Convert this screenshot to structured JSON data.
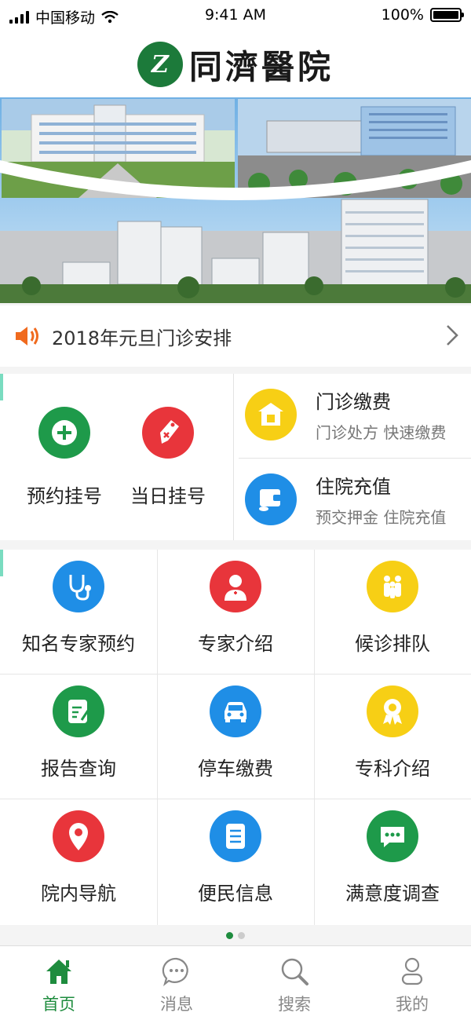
{
  "status_bar": {
    "carrier": "中国移动",
    "time": "9:41 AM",
    "battery": "100%"
  },
  "header": {
    "logo_mark": "Z",
    "title": "同濟醫院"
  },
  "notice": {
    "text": "2018年元旦门诊安排"
  },
  "features": {
    "left": [
      {
        "label": "预约挂号",
        "icon": "plus-icon",
        "color": "#1e9a4a"
      },
      {
        "label": "当日挂号",
        "icon": "tag-icon",
        "color": "#e8353b"
      }
    ],
    "right": [
      {
        "title": "门诊缴费",
        "subtitle": "门诊处方  快速缴费",
        "icon": "clinic-icon",
        "color": "#f7cf15"
      },
      {
        "title": "住院充值",
        "subtitle": "预交押金  住院充值",
        "icon": "wallet-icon",
        "color": "#1f8ee6"
      }
    ]
  },
  "grid": [
    {
      "label": "知名专家预约",
      "icon": "stethoscope-icon",
      "color": "#1f8ee6"
    },
    {
      "label": "专家介绍",
      "icon": "doctor-icon",
      "color": "#e8353b"
    },
    {
      "label": "候诊排队",
      "icon": "queue-icon",
      "color": "#f7cf15"
    },
    {
      "label": "报告查询",
      "icon": "report-icon",
      "color": "#1e9a4a"
    },
    {
      "label": "停车缴费",
      "icon": "car-icon",
      "color": "#1f8ee6"
    },
    {
      "label": "专科介绍",
      "icon": "badge-icon",
      "color": "#f7cf15"
    },
    {
      "label": "院内导航",
      "icon": "location-pin-icon",
      "color": "#e8353b"
    },
    {
      "label": "便民信息",
      "icon": "document-icon",
      "color": "#1f8ee6"
    },
    {
      "label": "满意度调查",
      "icon": "chat-icon",
      "color": "#1e9a4a"
    }
  ],
  "pager": {
    "page": 1,
    "total": 2
  },
  "tabs": [
    {
      "label": "首页",
      "icon": "home-icon",
      "active": true
    },
    {
      "label": "消息",
      "icon": "message-icon",
      "active": false
    },
    {
      "label": "搜索",
      "icon": "search-icon",
      "active": false
    },
    {
      "label": "我的",
      "icon": "user-icon",
      "active": false
    }
  ],
  "colors": {
    "brand_green": "#1e8c3e",
    "accent_teal": "#7adcc0"
  }
}
